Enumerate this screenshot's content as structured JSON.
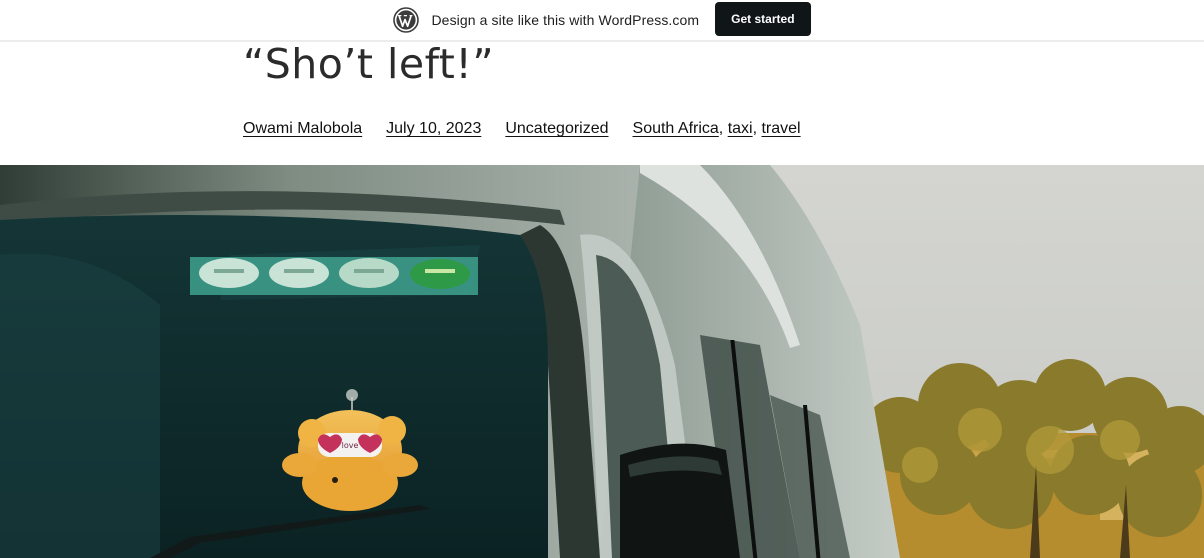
{
  "banner": {
    "icon": "wordpress-logo-icon",
    "text": "Design a site like this with WordPress.com",
    "button_label": "Get started"
  },
  "post": {
    "title": "“Sho’t left!”",
    "author": "Owami Malobola",
    "date": "July 10, 2023",
    "category": "Uncategorized",
    "tags": [
      "South Africa",
      "taxi",
      "travel"
    ]
  },
  "hero": {
    "icon": "taxi-photo",
    "sticker_text": "love"
  },
  "colors": {
    "banner_button": "#101517",
    "title": "#2b2b2b",
    "sky": "#cfd0cc",
    "windshield": "#0f2a2b",
    "van_body": "#5a6a5e",
    "foliage": "#b08a2a"
  }
}
